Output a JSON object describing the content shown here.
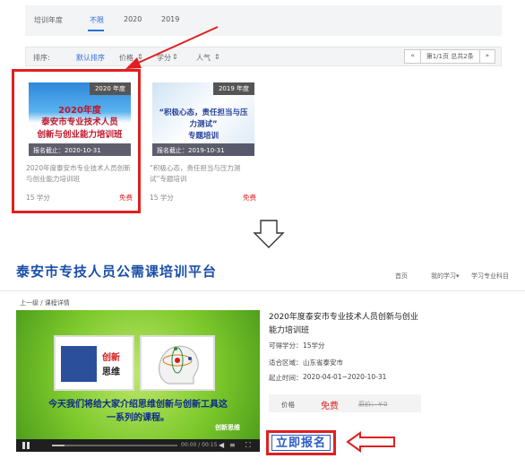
{
  "filter": {
    "year_label": "培训年度",
    "years": [
      "不限",
      "2020",
      "2019"
    ]
  },
  "sort": {
    "label": "排序:",
    "options": [
      "默认排序",
      "价格",
      "学分",
      "人气"
    ],
    "pager_prev": "«",
    "pager_info": "第1/1页 总共2条",
    "pager_next": "»"
  },
  "courses": [
    {
      "badge": "2020 年度",
      "thumb_lines": [
        "2020年度",
        "泰安市专业技术人员",
        "创新与创业能力培训班"
      ],
      "deadline": "报名截止：2020-10-31",
      "title": "2020年度泰安市专业技术人员创新与创业能力培训班",
      "credits": "15 学分",
      "price": "免费"
    },
    {
      "badge": "2019 年度",
      "thumb_lines": [
        "“积极心态，责任担当与压力测试”",
        "专题培训"
      ],
      "deadline": "报名截止：2019-10-31",
      "title": "“积极心态，责任担当与压力测试”专题培训",
      "credits": "15 学分",
      "price": "免费"
    }
  ],
  "platform": {
    "title": "泰安市专技人员公需课培训平台",
    "nav": [
      "首页",
      "我的学习▾",
      "学习专业科目"
    ]
  },
  "breadcrumb": "上一级  /  课程详情",
  "video": {
    "panel_label_1": "创新",
    "panel_label_2": "思维",
    "subtitle_1": "今天我们将给大家介绍思维创新与创新工具这",
    "subtitle_2": "一系列的课程。",
    "watermark": "创新思维",
    "time": "00:00 / 00:15"
  },
  "detail": {
    "title": "2020年度泰安市专业技术人员创新与创业能力培训班",
    "credits_label": "可得学分：",
    "credits_value": "15学分",
    "region_label": "适合区域：",
    "region_value": "山东省泰安市",
    "period_label": "起止时间：",
    "period_value": "2020-04-01~2020-10-31",
    "price_label": "价格",
    "price_value": "免费",
    "orig_price": "原价：￥0",
    "enroll_label": "立即报名"
  },
  "colors": {
    "accent_blue": "#2b6fd6",
    "highlight_red": "#e02020",
    "brand_blue": "#1a4fa8"
  }
}
